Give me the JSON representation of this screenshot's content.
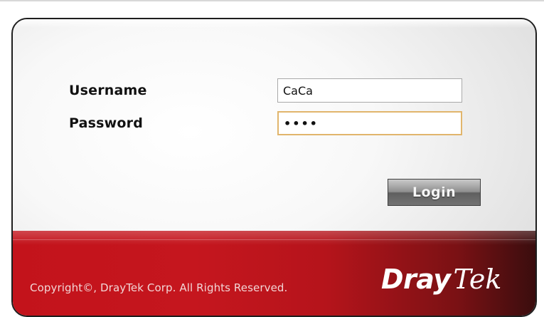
{
  "login_form": {
    "username_label": "Username",
    "password_label": "Password",
    "username_value": "CaCa",
    "password_value": "••••",
    "login_button_label": "Login"
  },
  "footer": {
    "copyright": "Copyright©, DrayTek Corp. All Rights Reserved.",
    "brand_part1": "Dray",
    "brand_part2": "Tek"
  },
  "colors": {
    "footer_red": "#c3131b",
    "footer_dark": "#3a0d0e",
    "focused_input_border": "#e1b56c",
    "button_gray": "#8e8e8e"
  }
}
